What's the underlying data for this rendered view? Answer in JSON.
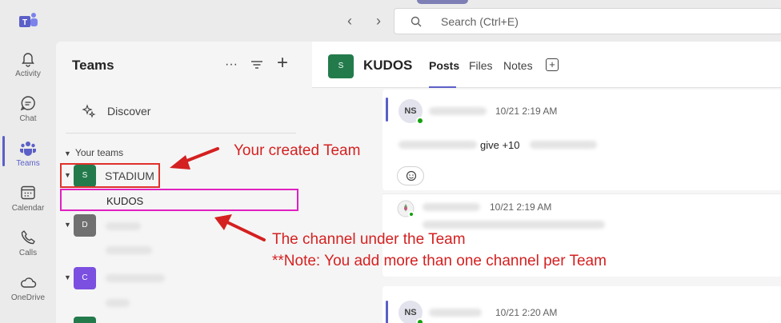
{
  "search": {
    "placeholder": "Search (Ctrl+E)"
  },
  "rail": {
    "items": [
      {
        "label": "Activity",
        "icon": "bell-icon"
      },
      {
        "label": "Chat",
        "icon": "chat-icon"
      },
      {
        "label": "Teams",
        "icon": "teams-icon",
        "active": true
      },
      {
        "label": "Calendar",
        "icon": "calendar-icon"
      },
      {
        "label": "Calls",
        "icon": "phone-icon"
      },
      {
        "label": "OneDrive",
        "icon": "cloud-icon"
      }
    ]
  },
  "panel": {
    "title": "Teams",
    "more": "···",
    "add": "+",
    "discover": "Discover",
    "section_label": "Your teams",
    "teams": [
      {
        "initial": "S",
        "name": "STADIUM",
        "color": "#237b4b"
      },
      {
        "initial": "D",
        "name": "",
        "color": "#707070"
      },
      {
        "initial": "C",
        "name": "",
        "color": "#7b4fe0"
      }
    ],
    "channel": "KUDOS"
  },
  "main": {
    "channel_initial": "S",
    "channel_title": "KUDOS",
    "tabs": [
      "Posts",
      "Files",
      "Notes"
    ],
    "posts": [
      {
        "initials": "NS",
        "time": "10/21 2:19 AM",
        "text": "give +10"
      },
      {
        "initials": "",
        "time": "10/21 2:19 AM"
      },
      {
        "initials": "NS",
        "time": "10/21 2:20 AM"
      }
    ]
  },
  "annotations": {
    "created_team": "Your created Team",
    "channel_line1": "The channel under the Team",
    "channel_line2": "**Note: You add more than one channel per Team"
  },
  "colors": {
    "accent": "#5b5fc7",
    "annotation_red": "#e0302a",
    "annotation_pink": "#e020c0"
  }
}
